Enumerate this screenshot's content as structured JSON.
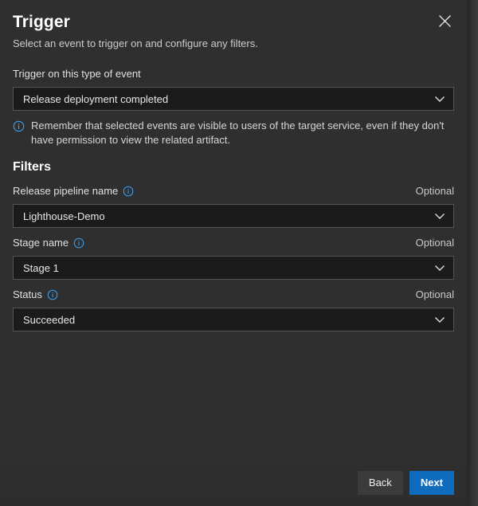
{
  "panel": {
    "title": "Trigger",
    "subtitle": "Select an event to trigger on and configure any filters.",
    "close_icon": "close-icon"
  },
  "event": {
    "label": "Trigger on this type of event",
    "selected": "Release deployment completed",
    "chevron_icon": "chevron-down-icon"
  },
  "info": {
    "icon": "info-circle-icon",
    "message": "Remember that selected events are visible to users of the target service, even if they don't have permission to view the related artifact."
  },
  "filters": {
    "heading": "Filters",
    "optional_label": "Optional",
    "info_icon": "info-circle-icon",
    "items": [
      {
        "label": "Release pipeline name",
        "selected": "Lighthouse-Demo",
        "optional": "Optional"
      },
      {
        "label": "Stage name",
        "selected": "Stage 1",
        "optional": "Optional"
      },
      {
        "label": "Status",
        "selected": "Succeeded",
        "optional": "Optional"
      }
    ]
  },
  "footer": {
    "back_label": "Back",
    "next_label": "Next"
  },
  "colors": {
    "panel_bg": "#2f2f2f",
    "field_bg": "#1b1b1b",
    "field_border": "#555555",
    "accent_blue": "#0f6cbd",
    "info_blue": "#3aa0f3",
    "text_primary": "#ffffff",
    "text_secondary": "#cccccc"
  }
}
